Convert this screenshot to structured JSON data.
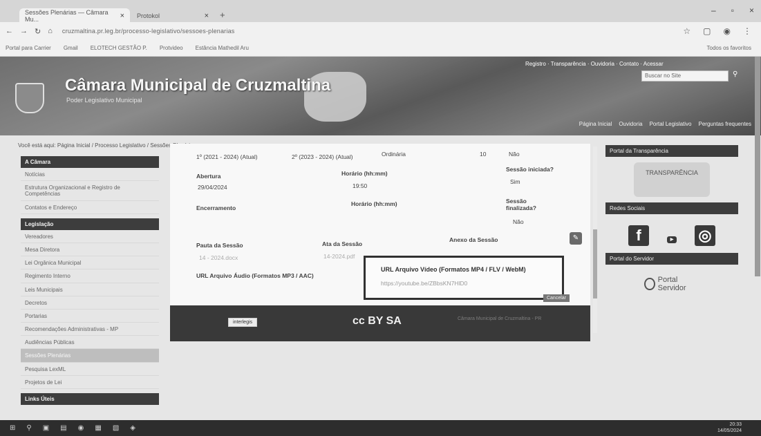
{
  "browser": {
    "tabs": [
      {
        "label": "Sessões Plenárias — Câmara Mu..."
      },
      {
        "label": "Protokol"
      }
    ],
    "url": "cruzmaltina.pr.leg.br/processo-legislativo/sessoes-plenarias",
    "bookmarks": [
      "Portal para Carrier",
      "Gmail",
      "ELOTECH GESTÃO P.",
      "Protvideo",
      "Estância Mathedil Aru"
    ],
    "all_bookmarks_label": "Todos os favoritos"
  },
  "banner": {
    "title": "Câmara Municipal de Cruzmaltina",
    "subtitle": "Poder Legislativo Municipal",
    "search_placeholder": "Buscar no Site",
    "top_links": "Registro · Transparência · Ouvidoria · Contato · Acessar",
    "menu": [
      "Página Inicial",
      "Ouvidoria",
      "Portal Legislativo",
      "Perguntas frequentes"
    ]
  },
  "breadcrumb": "Você está aqui: Página Inicial / Processo Legislativo / Sessões Plenárias",
  "left_nav": {
    "section_camara": "A Câmara",
    "camara_items": [
      "Notícias",
      "Estrutura Organizacional e Registro de Competências",
      "Contatos e Endereço"
    ],
    "section_legislacao": "Legislação",
    "legislacao_items": [
      "Vereadores",
      "Mesa Diretora",
      "Lei Orgânica Municipal",
      "Regimento Interno",
      "Leis Municipais",
      "Decretos",
      "Portarias",
      "Recomendações Administrativas - MP",
      "Audiências Públicas",
      "Sessões Plenárias",
      "Pesquisa LexML",
      "Projetos de Lei"
    ],
    "section_links": "Links Úteis"
  },
  "session": {
    "period1": "1º (2021 - 2024) (Atual)",
    "period2": "2º (2023 - 2024) (Atual)",
    "type": "Ordinária",
    "number": "10",
    "top_no": "Não",
    "abertura_label": "Abertura",
    "abertura_value": "29/04/2024",
    "horario_label": "Horário (hh:mm)",
    "horario_value": "19:50",
    "iniciada_label": "Sessão iniciada?",
    "iniciada_value": "Sim",
    "encerramento_label": "Encerramento",
    "horario2_label": "Horário (hh:mm)",
    "finalizada_label": "Sessão finalizada?",
    "finalizada_value": "Não",
    "pauta_label": "Pauta da Sessão",
    "pauta_value": "14 - 2024.docx",
    "ata_label": "Ata da Sessão",
    "ata_value": "14-2024.pdf",
    "anexo_label": "Anexo da Sessão",
    "audio_label": "URL Arquivo Áudio (Formatos MP3 / AAC)",
    "video_label": "URL Arquivo Vídeo (Formatos MP4 / FLV / WebM)",
    "video_value": "https://youtube.be/ZBbsKN7HlD0",
    "cancel_label": "Cancelar"
  },
  "footer": {
    "logo_text": "interlegis",
    "cc_label": "cc BY SA",
    "credit_text": "Câmara Municipal de Cruzmaltina - PR"
  },
  "right_nav": {
    "transparency_head": "Portal da Transparência",
    "transparency_badge": "TRANSPARÊNCIA",
    "social_head": "Redes Sociais",
    "servidor_head": "Portal do Servidor",
    "portal_label": "Portal Servidor"
  },
  "taskbar": {
    "time": "20:33",
    "date": "14/05/2024"
  }
}
